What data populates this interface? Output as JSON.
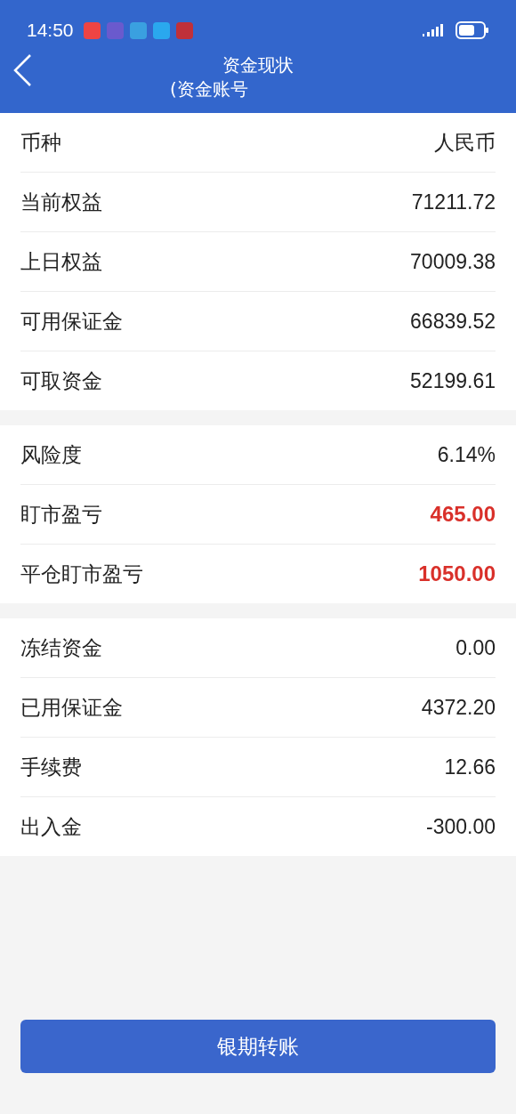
{
  "status_bar": {
    "time": "14:50"
  },
  "header": {
    "title": "资金现状",
    "subtitle": "(资金账号"
  },
  "sections": [
    {
      "rows": [
        {
          "label": "币种",
          "value": "人民币",
          "kind": "plain"
        },
        {
          "label": "当前权益",
          "value": "71211.72",
          "kind": "plain"
        },
        {
          "label": "上日权益",
          "value": "70009.38",
          "kind": "plain"
        },
        {
          "label": "可用保证金",
          "value": "66839.52",
          "kind": "plain"
        },
        {
          "label": "可取资金",
          "value": "52199.61",
          "kind": "plain"
        }
      ]
    },
    {
      "rows": [
        {
          "label": "风险度",
          "value": "6.14%",
          "kind": "plain"
        },
        {
          "label": "盯市盈亏",
          "value": "465.00",
          "kind": "profit"
        },
        {
          "label": "平仓盯市盈亏",
          "value": "1050.00",
          "kind": "profit"
        }
      ]
    },
    {
      "rows": [
        {
          "label": "冻结资金",
          "value": "0.00",
          "kind": "plain"
        },
        {
          "label": "已用保证金",
          "value": "4372.20",
          "kind": "plain"
        },
        {
          "label": "手续费",
          "value": "12.66",
          "kind": "plain"
        },
        {
          "label": "出入金",
          "value": "-300.00",
          "kind": "plain"
        }
      ]
    }
  ],
  "button": {
    "label": "银期转账"
  }
}
